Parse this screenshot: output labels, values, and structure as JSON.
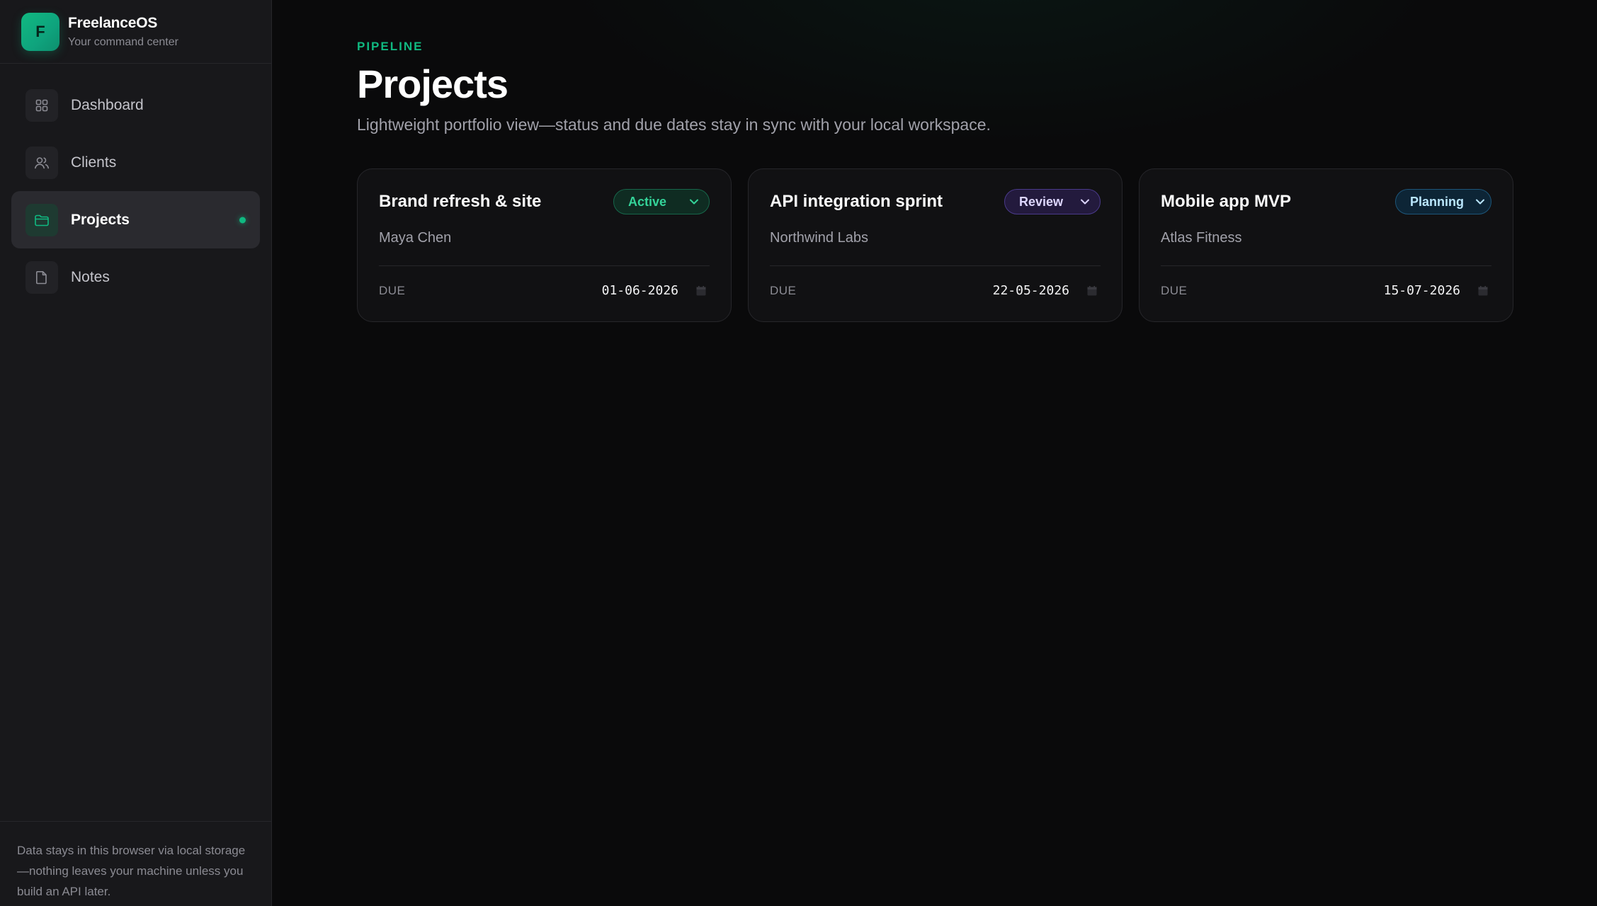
{
  "brand": {
    "logo_letter": "F",
    "name": "FreelanceOS",
    "tagline": "Your command center"
  },
  "sidebar": {
    "items": [
      {
        "label": "Dashboard",
        "icon": "grid-icon",
        "active": false
      },
      {
        "label": "Clients",
        "icon": "users-icon",
        "active": false
      },
      {
        "label": "Projects",
        "icon": "folder-icon",
        "active": true
      },
      {
        "label": "Notes",
        "icon": "document-icon",
        "active": false
      }
    ],
    "footer_text": "Data stays in this browser via local storage—nothing leaves your machine unless you build an API later."
  },
  "header": {
    "eyebrow": "PIPELINE",
    "title": "Projects",
    "subtitle": "Lightweight portfolio view—status and due dates stay in sync with your local workspace."
  },
  "projects": [
    {
      "title": "Brand refresh & site",
      "client": "Maya Chen",
      "status": "Active",
      "due_label": "DUE",
      "due_date": "01-06-2026"
    },
    {
      "title": "API integration sprint",
      "client": "Northwind Labs",
      "status": "Review",
      "due_label": "DUE",
      "due_date": "22-05-2026"
    },
    {
      "title": "Mobile app MVP",
      "client": "Atlas Fitness",
      "status": "Planning",
      "due_label": "DUE",
      "due_date": "15-07-2026"
    }
  ],
  "colors": {
    "accent": "#10b981",
    "background": "#0a0a0b",
    "sidebar": "#18181b",
    "status_active": "#34d399",
    "status_review": "#ddd6fe",
    "status_planning": "#bae6fd"
  }
}
